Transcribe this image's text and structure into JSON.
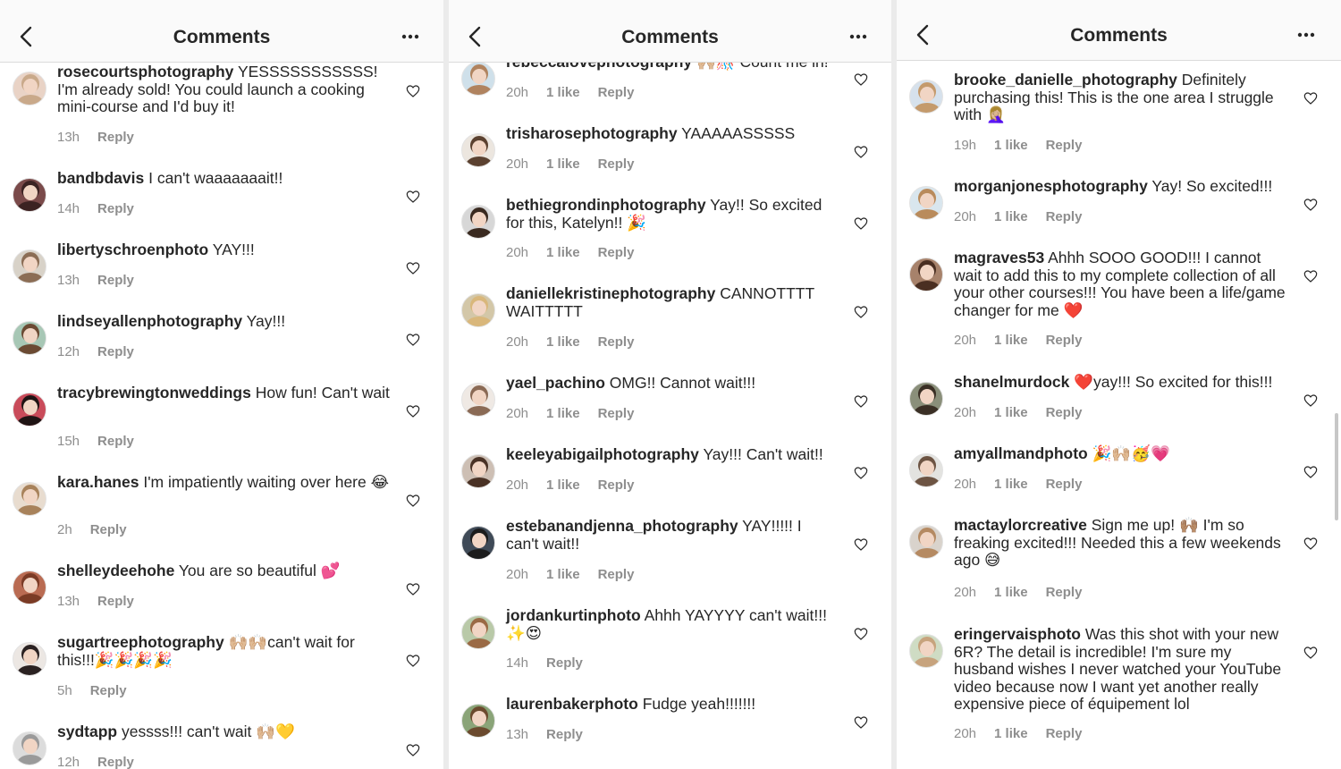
{
  "header": {
    "title": "Comments"
  },
  "panels": [
    {
      "comments": [
        {
          "user": "rosecourtsphotography",
          "text": "YESSSSSSSSSSS! I'm already sold! You could launch a cooking mini-course and I'd buy it!",
          "time": "13h",
          "likes": "",
          "reply": "Reply",
          "avatar_color": "#e9d3c6",
          "hair_color": "#c9a98a"
        },
        {
          "user": "bandbdavis",
          "text": "I can't waaaaaaait!!",
          "time": "14h",
          "likes": "",
          "reply": "Reply",
          "avatar_color": "#7a4a4a",
          "hair_color": "#3b2222"
        },
        {
          "user": "libertyschroenphoto",
          "text": "YAY!!!",
          "time": "13h",
          "likes": "",
          "reply": "Reply",
          "avatar_color": "#d8d2c8",
          "hair_color": "#8b6d55"
        },
        {
          "user": "lindseyallenphotography",
          "text": "Yay!!!",
          "time": "12h",
          "likes": "",
          "reply": "Reply",
          "avatar_color": "#a7c7b5",
          "hair_color": "#6b4a33"
        },
        {
          "user": "tracybrewingtonweddings",
          "text": "How fun! Can't wait",
          "time": "15h",
          "likes": "",
          "reply": "Reply",
          "avatar_color": "#c94b5a",
          "hair_color": "#1f1414"
        },
        {
          "user": "kara.hanes",
          "text": "I'm impatiently waiting over here 😂",
          "time": "2h",
          "likes": "",
          "reply": "Reply",
          "avatar_color": "#e8dccf",
          "hair_color": "#a8825b"
        },
        {
          "user": "shelleydeehohe",
          "text": "You are so beautiful 💕",
          "time": "13h",
          "likes": "",
          "reply": "Reply",
          "avatar_color": "#b96b52",
          "hair_color": "#7a3b25"
        },
        {
          "user": "sugartreephotography",
          "text": "🙌🏼🙌🏼can't wait for this!!!🎉🎉🎉🎉",
          "time": "5h",
          "likes": "",
          "reply": "Reply",
          "avatar_color": "#ece7e3",
          "hair_color": "#2b2222"
        },
        {
          "user": "sydtapp",
          "text": "yessss!!! can't wait 🙌🏼💛",
          "time": "12h",
          "likes": "",
          "reply": "Reply",
          "avatar_color": "#dcdcdc",
          "hair_color": "#9a9a9a"
        }
      ]
    },
    {
      "comments": [
        {
          "user": "rebeccalovephotography",
          "text": "🙌🏼🎊 Count me in!",
          "time": "20h",
          "likes": "1 like",
          "reply": "Reply",
          "avatar_color": "#cfe0ea",
          "hair_color": "#b0835f"
        },
        {
          "user": "trisharosephotography",
          "text": "YAAAAASSSSS",
          "time": "20h",
          "likes": "1 like",
          "reply": "Reply",
          "avatar_color": "#ece6df",
          "hair_color": "#5b4130"
        },
        {
          "user": "bethiegrondinphotography",
          "text": "Yay!! So excited for this, Katelyn!! 🎉",
          "time": "20h",
          "likes": "1 like",
          "reply": "Reply",
          "avatar_color": "#d7d7d7",
          "hair_color": "#3a2a20"
        },
        {
          "user": "daniellekristinephotography",
          "text": "CANNOTTTT WAITTTTT",
          "time": "20h",
          "likes": "1 like",
          "reply": "Reply",
          "avatar_color": "#d3c7a8",
          "hair_color": "#d9b77b"
        },
        {
          "user": "yael_pachino",
          "text": "OMG!! Cannot wait!!!",
          "time": "20h",
          "likes": "1 like",
          "reply": "Reply",
          "avatar_color": "#efe9e4",
          "hair_color": "#8a6a55"
        },
        {
          "user": "keeleyabigailphotography",
          "text": "Yay!!! Can't wait!!",
          "time": "20h",
          "likes": "1 like",
          "reply": "Reply",
          "avatar_color": "#cdbfb4",
          "hair_color": "#4a3225"
        },
        {
          "user": "estebanandjenna_photography",
          "text": "YAY!!!!! I can't wait!!",
          "time": "20h",
          "likes": "1 like",
          "reply": "Reply",
          "avatar_color": "#3f4a57",
          "hair_color": "#1c1c1c"
        },
        {
          "user": "jordankurtinphoto",
          "text": "Ahhh YAYYYY can't wait!!! ✨😍",
          "time": "14h",
          "likes": "",
          "reply": "Reply",
          "avatar_color": "#b9c9a8",
          "hair_color": "#9a6a45"
        },
        {
          "user": "laurenbakerphoto",
          "text": "Fudge yeah!!!!!!!",
          "time": "13h",
          "likes": "",
          "reply": "Reply",
          "avatar_color": "#8aa478",
          "hair_color": "#6b4a2e"
        }
      ]
    },
    {
      "comments": [
        {
          "user": "brooke_danielle_photography",
          "text": "Definitely purchasing this! This is the one area I struggle with 🤦🏼‍♀️",
          "time": "19h",
          "likes": "1 like",
          "reply": "Reply",
          "avatar_color": "#d6e1ec",
          "hair_color": "#c49a6c"
        },
        {
          "user": "morganjonesphotography",
          "text": "Yay! So excited!!!",
          "time": "20h",
          "likes": "1 like",
          "reply": "Reply",
          "avatar_color": "#d9e6ee",
          "hair_color": "#b98b5c"
        },
        {
          "user": "magraves53",
          "text": "Ahhh SOOO GOOD!!! I cannot wait to add this to my complete collection of all your other courses!!! You have been a life/game changer for me ❤️",
          "time": "20h",
          "likes": "1 like",
          "reply": "Reply",
          "avatar_color": "#a7826b",
          "hair_color": "#4a2f22"
        },
        {
          "user": "shanelmurdock",
          "text": "❤️yay!!! So excited for this!!!",
          "time": "20h",
          "likes": "1 like",
          "reply": "Reply",
          "avatar_color": "#8a8f7a",
          "hair_color": "#3a2f25"
        },
        {
          "user": "amyallmandphoto",
          "text": "🎉🙌🏼🥳💗",
          "time": "20h",
          "likes": "1 like",
          "reply": "Reply",
          "avatar_color": "#e3e3e0",
          "hair_color": "#6d5443"
        },
        {
          "user": "mactaylorcreative",
          "text": "Sign me up! 🙌🏽 I'm so freaking excited!!! Needed this a few weekends ago 😅",
          "time": "20h",
          "likes": "1 like",
          "reply": "Reply",
          "avatar_color": "#d9d3cc",
          "hair_color": "#b58a62"
        },
        {
          "user": "eringervaisphoto",
          "text": "Was this shot with your new 6R? The detail is incredible! I'm sure my husband wishes I never watched your YouTube video because now I want yet another really expensive piece of équipement lol",
          "time": "20h",
          "likes": "1 like",
          "reply": "Reply",
          "avatar_color": "#cfdcc4",
          "hair_color": "#c7a37d"
        }
      ]
    }
  ]
}
